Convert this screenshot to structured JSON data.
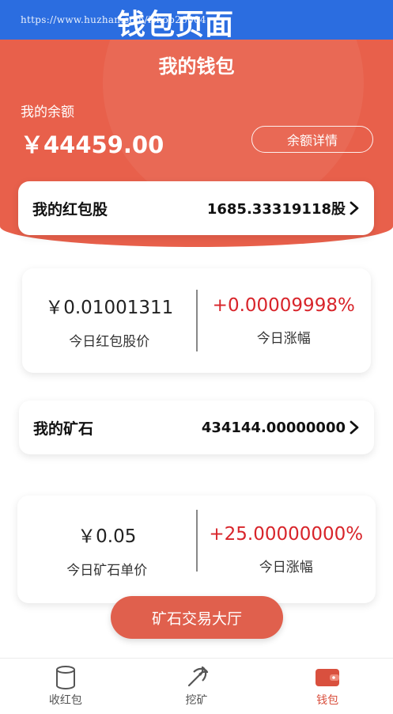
{
  "banner": {
    "url": "https://www.huzhan.com/ishop26004",
    "title": "钱包页面"
  },
  "header": {
    "title": "我的钱包",
    "balance_label": "我的余额",
    "balance_amount": "￥44459.00",
    "detail_button": "余额详情"
  },
  "red_packet_shares": {
    "title": "我的红包股",
    "value": "1685.33319118股"
  },
  "share_stats": {
    "price_value": "￥0.01001311",
    "price_label": "今日红包股价",
    "change_value": "+0.00009998%",
    "change_label": "今日涨幅"
  },
  "ore": {
    "title": "我的矿石",
    "value": "434144.00000000"
  },
  "ore_stats": {
    "price_value": "￥0.05",
    "price_label": "今日矿石单价",
    "change_value": "+25.00000000%",
    "change_label": "今日涨幅"
  },
  "trade_button": "矿石交易大厅",
  "tabbar": {
    "items": [
      {
        "label": "收红包",
        "icon": "cylinder-icon"
      },
      {
        "label": "挖矿",
        "icon": "pickaxe-icon"
      },
      {
        "label": "钱包",
        "icon": "wallet-icon",
        "active": true
      }
    ]
  },
  "colors": {
    "brand": "#e8604b",
    "positive": "#d8242a",
    "banner": "#2b6de0"
  }
}
